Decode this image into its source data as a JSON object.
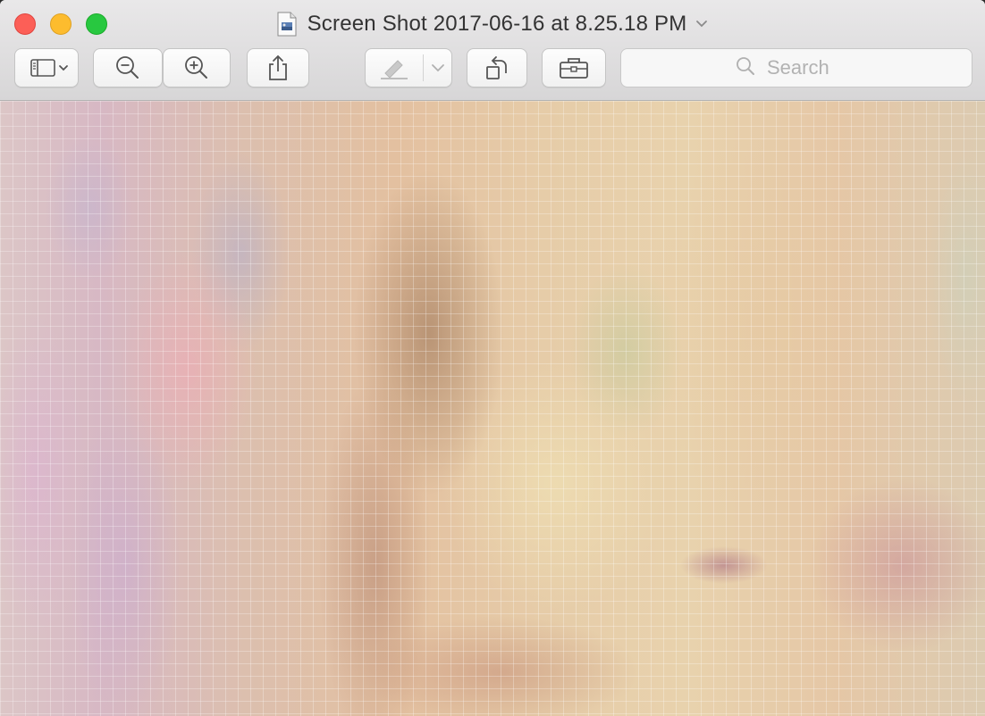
{
  "window": {
    "title": "Screen Shot 2017-06-16 at 8.25.18 PM",
    "icons": {
      "document": "document-icon",
      "title_menu": "chevron-down-icon"
    }
  },
  "toolbar": {
    "sidebar_button": "sidebar-toggle-icon",
    "zoom_out_button": "zoom-out-icon",
    "zoom_in_button": "zoom-in-icon",
    "share_button": "share-icon",
    "markup_button": "pen-icon",
    "markup_menu": "chevron-down-icon",
    "rotate_button": "rotate-left-icon",
    "toolbox_button": "toolbox-icon"
  },
  "search": {
    "placeholder": "Search",
    "icon": "search-icon"
  },
  "colors": {
    "close": "#fc5f57",
    "minimize": "#fdbc2e",
    "maximize": "#28c840"
  }
}
